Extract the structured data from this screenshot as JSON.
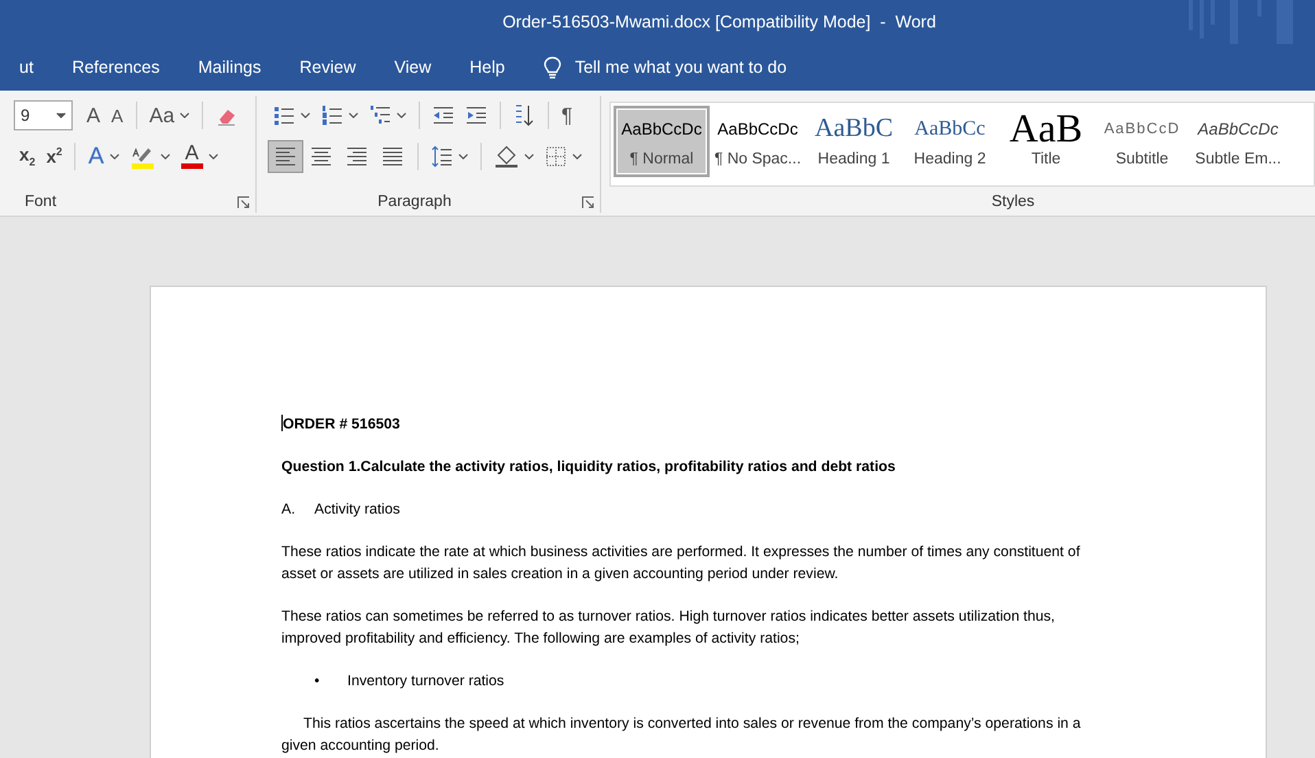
{
  "window": {
    "title": "Order-516503-Mwami.docx [Compatibility Mode]  -  Word"
  },
  "ribbon_tabs": [
    {
      "label": "ut"
    },
    {
      "label": "References"
    },
    {
      "label": "Mailings"
    },
    {
      "label": "Review"
    },
    {
      "label": "View"
    },
    {
      "label": "Help"
    }
  ],
  "tell_me": {
    "placeholder": "Tell me what you want to do"
  },
  "font_group": {
    "label": "Font",
    "font_size": "9",
    "grow_glyph": "A",
    "shrink_glyph": "A",
    "change_case_glyph": "Aa",
    "subscript_glyph": "x$_{2}$",
    "superscript_glyph": "x$^{2}$",
    "text_effects_glyph": "A",
    "font_color_glyph": "A"
  },
  "paragraph_group": {
    "label": "Paragraph",
    "show_marks_glyph": "¶",
    "alignments": [
      {
        "kind": "left",
        "selected": true
      },
      {
        "kind": "center",
        "selected": false
      },
      {
        "kind": "right",
        "selected": false
      },
      {
        "kind": "justify",
        "selected": false
      }
    ]
  },
  "styles_group": {
    "label": "Styles",
    "styles": [
      {
        "kind": "normal",
        "preview": "AaBbCcDc",
        "name": "¶ Normal",
        "selected": true
      },
      {
        "kind": "normal",
        "preview": "AaBbCcDc",
        "name": "¶ No Spac...",
        "selected": false
      },
      {
        "kind": "heading1",
        "preview": "AaBbC",
        "name": "Heading 1",
        "selected": false
      },
      {
        "kind": "heading2",
        "preview": "AaBbCc",
        "name": "Heading 2",
        "selected": false
      },
      {
        "kind": "title",
        "preview": "AaB",
        "name": "Title",
        "selected": false
      },
      {
        "kind": "subtitle",
        "preview": "AaBbCcD",
        "name": "Subtitle",
        "selected": false
      },
      {
        "kind": "emphasis",
        "preview": "AaBbCcDc",
        "name": "Subtle Em...",
        "selected": false
      }
    ]
  },
  "document": {
    "paragraphs": [
      {
        "kind": "heading",
        "text": "ORDER # 516503"
      },
      {
        "kind": "heading",
        "text": "Question 1.Calculate the activity ratios, liquidity ratios, profitability ratios and debt ratios"
      },
      {
        "kind": "lettered",
        "marker": "A.",
        "text": "Activity ratios"
      },
      {
        "kind": "body",
        "text": "These ratios indicate the rate at which business activities are performed. It expresses the number of times any constituent of asset or assets are utilized in sales creation in a given accounting period under review."
      },
      {
        "kind": "body",
        "text": "These ratios can sometimes be referred to as turnover ratios. High turnover ratios indicates better assets utilization thus, improved profitability and efficiency. The following are examples of activity ratios;"
      },
      {
        "kind": "bullet",
        "marker": "•",
        "text": "Inventory turnover ratios"
      },
      {
        "kind": "indented",
        "text": "This ratios ascertains the speed at which inventory is converted into sales or revenue from the company’s operations in a given accounting period."
      }
    ]
  }
}
